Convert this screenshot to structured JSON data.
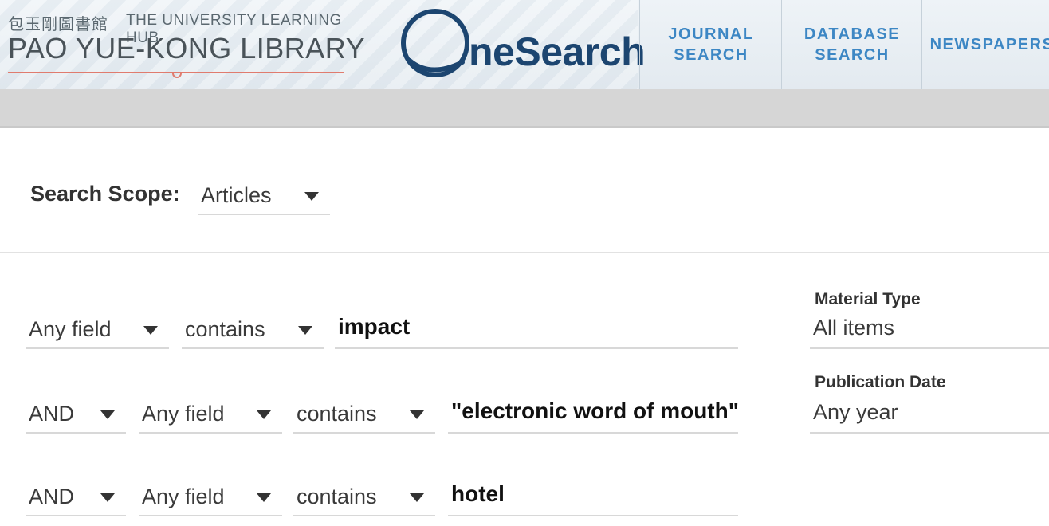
{
  "header": {
    "library_cjk": "包玉剛圖書館",
    "library_tagline": "THE UNIVERSITY LEARNING HUB",
    "library_name": "PAO YUE-KONG LIBRARY",
    "product_name": "neSearch",
    "nav": [
      {
        "label": "JOURNAL\nSEARCH"
      },
      {
        "label": "DATABASE\nSEARCH"
      },
      {
        "label": "NEWSPAPERS"
      }
    ],
    "colors": {
      "brand_dark": "#1c4570",
      "nav_link": "#3d87c4",
      "accent_line": "#e07b6e"
    }
  },
  "scope": {
    "label": "Search Scope:",
    "value": "Articles"
  },
  "query_rows": [
    {
      "operator": "",
      "field": "Any field",
      "condition": "contains",
      "term": "impact"
    },
    {
      "operator": "AND",
      "field": "Any field",
      "condition": "contains",
      "term": "\"electronic word of mouth\""
    },
    {
      "operator": "AND",
      "field": "Any field",
      "condition": "contains",
      "term": "hotel"
    }
  ],
  "facets": {
    "material_type": {
      "title": "Material Type",
      "value": "All items"
    },
    "publication_date": {
      "title": "Publication Date",
      "value": "Any year"
    }
  },
  "icons": [
    "caret-down-icon",
    "onesearch-q-logo-icon"
  ]
}
